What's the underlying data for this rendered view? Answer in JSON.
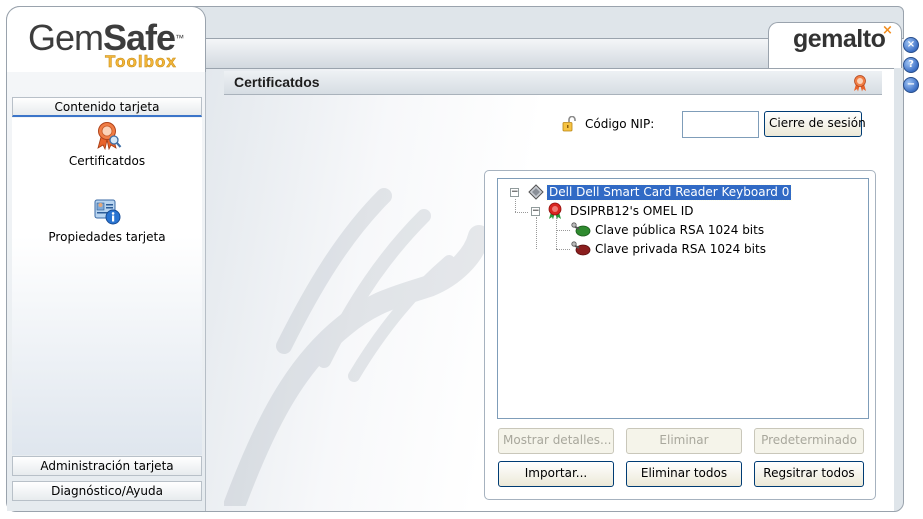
{
  "logo": {
    "brand_light": "Gem",
    "brand_bold": "Safe",
    "tm": "™",
    "sub": "Toolbox"
  },
  "vendor": {
    "name": "gemalto",
    "mark": "×"
  },
  "window_buttons": {
    "close": "×",
    "help": "?",
    "minimize": "−"
  },
  "sidebar": {
    "section_card_contents": "Contenido tarjeta",
    "items": [
      {
        "label": "Certificatdos",
        "icon": "certificate-icon"
      },
      {
        "label": "Propiedades tarjeta",
        "icon": "card-properties-icon"
      }
    ],
    "section_card_admin": "Administración tarjeta",
    "section_diagnostics": "Diagnóstico/Ayuda"
  },
  "main": {
    "title": "Certificatdos",
    "pin_label": "Código NIP:",
    "pin_value": "",
    "logout_button": "Cierre de sesión",
    "tree": [
      {
        "label": "Dell Dell Smart Card Reader Keyboard 0",
        "icon": "card-reader-icon",
        "level": 0,
        "selected": true
      },
      {
        "label": "DSIPRB12's OMEL ID",
        "icon": "certificate-icon",
        "level": 1,
        "selected": false
      },
      {
        "label": "Clave pública RSA 1024 bits",
        "icon": "public-key-icon",
        "level": 2,
        "selected": false
      },
      {
        "label": "Clave privada RSA 1024 bits",
        "icon": "private-key-icon",
        "level": 2,
        "selected": false
      }
    ],
    "buttons": {
      "show_details": "Mostrar detalles...",
      "delete": "Eliminar",
      "default": "Predeterminado",
      "import": "Importar...",
      "delete_all": "Eliminar todos",
      "register_all": "Regsitrar todos"
    }
  },
  "colors": {
    "accent": "#316ac5",
    "logo_orange": "#f3b63a",
    "vendor_mark": "#f28c1c"
  }
}
